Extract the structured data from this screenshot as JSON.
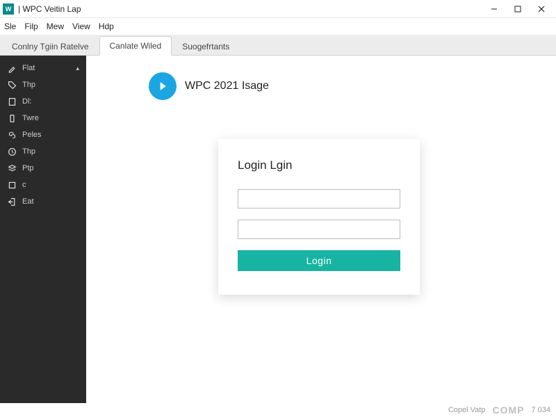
{
  "window": {
    "title": "| WPC Veitin Lap"
  },
  "menubar": [
    "Sle",
    "Filp",
    "Mew",
    "View",
    "Hdp"
  ],
  "tabs": [
    {
      "label": "Conlny Tgiin Ratelve",
      "active": false
    },
    {
      "label": "Canlate Wiled",
      "active": true
    },
    {
      "label": "Suogefrtants",
      "active": false
    }
  ],
  "sidebar": {
    "items": [
      {
        "icon": "brush-icon",
        "label": "Flat",
        "has_chevron": true
      },
      {
        "icon": "tag-icon",
        "label": "Thp"
      },
      {
        "icon": "page-icon",
        "label": "Dl:"
      },
      {
        "icon": "phone-icon",
        "label": "Twre"
      },
      {
        "icon": "link-icon",
        "label": "Peles"
      },
      {
        "icon": "clock-icon",
        "label": "Thp"
      },
      {
        "icon": "layers-icon",
        "label": "Ptp"
      },
      {
        "icon": "square-icon",
        "label": "c"
      },
      {
        "icon": "exit-icon",
        "label": "Eat"
      }
    ]
  },
  "page": {
    "heading": "WPC 2021 Isage"
  },
  "login": {
    "heading": "Login Lgin",
    "username_value": "",
    "password_value": "",
    "button_label": "Login"
  },
  "status": {
    "left": "Copel Vatp",
    "brand": "COMP",
    "right": "7 034"
  },
  "colors": {
    "accent_blue": "#1ba6e2",
    "accent_teal": "#17b3a3",
    "sidebar_bg": "#2a2a2a"
  }
}
